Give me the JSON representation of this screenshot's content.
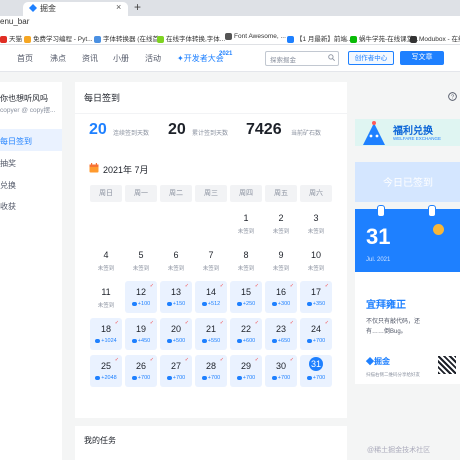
{
  "browser": {
    "tab_title": "掘金",
    "tab_close": "×",
    "new_tab": "+",
    "url_text": "enu_bar",
    "bookmarks": [
      {
        "label": "天猫",
        "color": "#e02e24"
      },
      {
        "label": "免费学习编程 - Pyt...",
        "color": "#f5a623"
      },
      {
        "label": "字体转换器 (在线首...",
        "color": "#4a90e2"
      },
      {
        "label": "在线字体转换,字体...",
        "color": "#7ed321"
      },
      {
        "label": "Font Awesome, ...",
        "color": "#555555"
      },
      {
        "label": "【1 月最新】前端...",
        "color": "#1e80ff"
      },
      {
        "label": "蜗牛学苑-在线课堂...",
        "color": "#09bb07"
      },
      {
        "label": "Modubox - 在线...",
        "color": "#333333"
      }
    ]
  },
  "header": {
    "nav": [
      "首页",
      "沸点",
      "资讯",
      "小册",
      "活动"
    ],
    "dev_conf": "开发者大会",
    "dev_conf_year": "2021",
    "search_placeholder": "探索掘金",
    "creator_center": "创作者中心",
    "write_article": "写文章"
  },
  "sidebar": {
    "username": "你也想听风吗",
    "subtitle": "copyer @ copy摆...",
    "items": [
      "每日签到",
      "抽奖",
      "兑换",
      "收获"
    ]
  },
  "main": {
    "title": "每日签到",
    "stats": [
      {
        "value": "20",
        "label": "连续签到天数"
      },
      {
        "value": "20",
        "label": "累计签到天数"
      },
      {
        "value": "7426",
        "label": "当前矿石数"
      }
    ],
    "month": "2021年 7月",
    "weekdays": [
      "周日",
      "周一",
      "周二",
      "周三",
      "周四",
      "周五",
      "周六"
    ],
    "status_unsigned": "未签到",
    "status_signed_check": "✓",
    "days": [
      {
        "day": "1",
        "status": "未签到"
      },
      {
        "day": "2",
        "status": "未签到"
      },
      {
        "day": "3",
        "status": "未签到"
      },
      {
        "day": "4",
        "status": "未签到"
      },
      {
        "day": "5",
        "status": "未签到"
      },
      {
        "day": "6",
        "status": "未签到"
      },
      {
        "day": "7",
        "status": "未签到"
      },
      {
        "day": "8",
        "status": "未签到"
      },
      {
        "day": "9",
        "status": "未签到"
      },
      {
        "day": "10",
        "status": "未签到"
      },
      {
        "day": "11",
        "status": "未签到"
      },
      {
        "day": "12",
        "status": "+100",
        "signed": true
      },
      {
        "day": "13",
        "status": "+150",
        "signed": true
      },
      {
        "day": "14",
        "status": "+512",
        "signed": true
      },
      {
        "day": "15",
        "status": "+250",
        "signed": true
      },
      {
        "day": "16",
        "status": "+300",
        "signed": true
      },
      {
        "day": "17",
        "status": "+350",
        "signed": true
      },
      {
        "day": "18",
        "status": "+1024",
        "signed": true
      },
      {
        "day": "19",
        "status": "+450",
        "signed": true
      },
      {
        "day": "20",
        "status": "+500",
        "signed": true
      },
      {
        "day": "21",
        "status": "+550",
        "signed": true
      },
      {
        "day": "22",
        "status": "+600",
        "signed": true
      },
      {
        "day": "23",
        "status": "+650",
        "signed": true
      },
      {
        "day": "24",
        "status": "+700",
        "signed": true
      },
      {
        "day": "25",
        "status": "+2048",
        "signed": true
      },
      {
        "day": "26",
        "status": "+700",
        "signed": true
      },
      {
        "day": "27",
        "status": "+700",
        "signed": true
      },
      {
        "day": "28",
        "status": "+700",
        "signed": true
      },
      {
        "day": "29",
        "status": "+700",
        "signed": true
      },
      {
        "day": "30",
        "status": "+700",
        "signed": true
      },
      {
        "day": "31",
        "status": "+700",
        "signed": true,
        "today": true
      }
    ],
    "tasks_title": "我的任务"
  },
  "right": {
    "banner_title": "福利兑换",
    "banner_sub": "WELFARE EXCHANGE",
    "signed_today": "今日已签到",
    "date_day": "31",
    "date_sub": "Jul. 2021",
    "yi": "宜拜雍正",
    "fortune_line1": "不仅只有敲代码，还",
    "fortune_line2": "有……倒Bug。",
    "logo_text": "掘金",
    "logo_sub": "扫描右侧二维码分享给好友"
  },
  "watermark": "@稀土掘金技术社区",
  "colors": {
    "brand": "#1e80ff",
    "signed_bg": "#eaf2ff"
  }
}
